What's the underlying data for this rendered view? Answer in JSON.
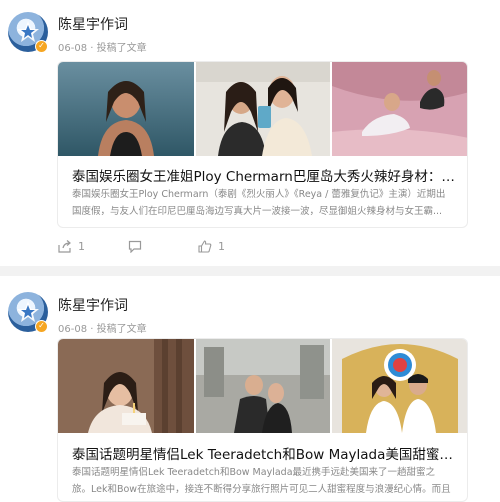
{
  "posts": [
    {
      "author": "陈星宇作词",
      "date": "06-08",
      "action": "投稿了文章",
      "title": "泰国娱乐圈女王准姐Ploy Chermarn巴厘岛大秀火辣好身材：被爆...",
      "desc": "泰国娱乐圈女王Ploy Chermarn（泰剧《烈火丽人》《Reya / 蕾雅复仇记》主演）近期出国度假，与友人们在印尼巴厘岛海边写真大片一波接一波，尽显御姐火辣身材与女王霸...",
      "share_count": "1",
      "comment_count": "",
      "like_count": "1"
    },
    {
      "author": "陈星宇作词",
      "date": "06-08",
      "action": "投稿了文章",
      "title": "泰国话题明星情侣Lek Teeradetch和Bow Maylada美国甜蜜之旅：...",
      "desc": "泰国话题明星情侣Lek Teeradetch和Bow Maylada最近携手远赴美国来了一趟甜蜜之旅。Lek和Bow在旅途中，接连不断得分享旅行照片可见二人甜蜜程度与浪漫纪心情。而且Lek..."
    }
  ],
  "icons": {
    "share": "share-icon",
    "comment": "comment-icon",
    "like": "thumbs-up-icon"
  },
  "colors": {
    "verified": "#f6a623",
    "avatar": "#2b5f9c"
  }
}
